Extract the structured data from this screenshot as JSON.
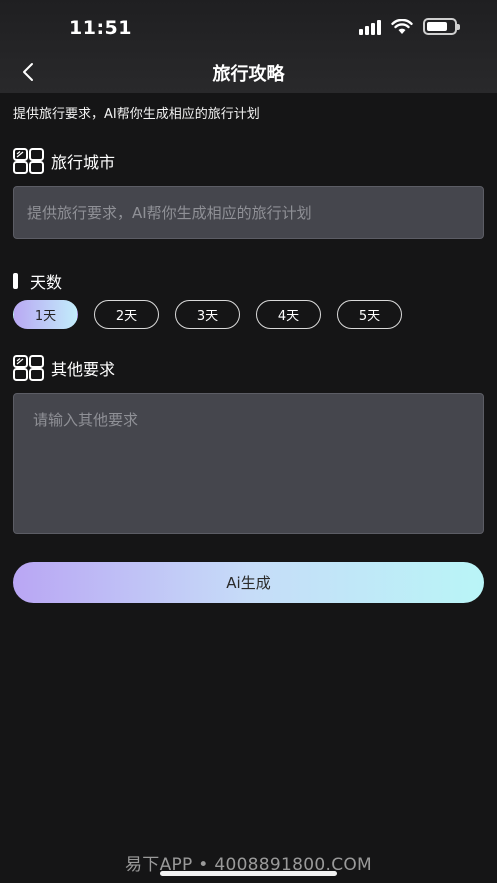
{
  "status_bar": {
    "time": "11:51",
    "battery_level": 0.75
  },
  "header": {
    "title": "旅行攻略",
    "back_icon": "chevron-left-icon"
  },
  "intro_text": "提供旅行要求，AI帮你生成相应的旅行计划",
  "city": {
    "label": "旅行城市",
    "icon": "grid-icon",
    "value": "",
    "placeholder": "提供旅行要求，AI帮你生成相应的旅行计划"
  },
  "days": {
    "label": "天数",
    "options": [
      "1天",
      "2天",
      "3天",
      "4天",
      "5天"
    ],
    "selected": "1天"
  },
  "other": {
    "label": "其他要求",
    "icon": "grid-icon",
    "value": "",
    "placeholder": "请输入其他要求"
  },
  "generate_button": {
    "label": "Ai生成"
  },
  "watermark": "易下APP • 4008891800.COM",
  "colors": {
    "background": "#151516",
    "input_background": "#45464d",
    "gradient_start": "#b9a6f4",
    "gradient_end": "#b9f5f7"
  }
}
